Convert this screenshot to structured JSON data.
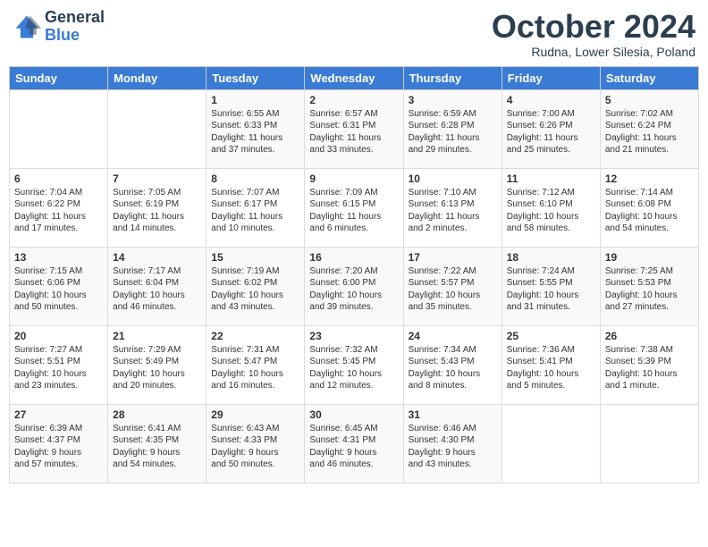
{
  "header": {
    "logo_general": "General",
    "logo_blue": "Blue",
    "month_title": "October 2024",
    "subtitle": "Rudna, Lower Silesia, Poland"
  },
  "days_of_week": [
    "Sunday",
    "Monday",
    "Tuesday",
    "Wednesday",
    "Thursday",
    "Friday",
    "Saturday"
  ],
  "weeks": [
    [
      {
        "day": "",
        "info": ""
      },
      {
        "day": "",
        "info": ""
      },
      {
        "day": "1",
        "info": "Sunrise: 6:55 AM\nSunset: 6:33 PM\nDaylight: 11 hours\nand 37 minutes."
      },
      {
        "day": "2",
        "info": "Sunrise: 6:57 AM\nSunset: 6:31 PM\nDaylight: 11 hours\nand 33 minutes."
      },
      {
        "day": "3",
        "info": "Sunrise: 6:59 AM\nSunset: 6:28 PM\nDaylight: 11 hours\nand 29 minutes."
      },
      {
        "day": "4",
        "info": "Sunrise: 7:00 AM\nSunset: 6:26 PM\nDaylight: 11 hours\nand 25 minutes."
      },
      {
        "day": "5",
        "info": "Sunrise: 7:02 AM\nSunset: 6:24 PM\nDaylight: 11 hours\nand 21 minutes."
      }
    ],
    [
      {
        "day": "6",
        "info": "Sunrise: 7:04 AM\nSunset: 6:22 PM\nDaylight: 11 hours\nand 17 minutes."
      },
      {
        "day": "7",
        "info": "Sunrise: 7:05 AM\nSunset: 6:19 PM\nDaylight: 11 hours\nand 14 minutes."
      },
      {
        "day": "8",
        "info": "Sunrise: 7:07 AM\nSunset: 6:17 PM\nDaylight: 11 hours\nand 10 minutes."
      },
      {
        "day": "9",
        "info": "Sunrise: 7:09 AM\nSunset: 6:15 PM\nDaylight: 11 hours\nand 6 minutes."
      },
      {
        "day": "10",
        "info": "Sunrise: 7:10 AM\nSunset: 6:13 PM\nDaylight: 11 hours\nand 2 minutes."
      },
      {
        "day": "11",
        "info": "Sunrise: 7:12 AM\nSunset: 6:10 PM\nDaylight: 10 hours\nand 58 minutes."
      },
      {
        "day": "12",
        "info": "Sunrise: 7:14 AM\nSunset: 6:08 PM\nDaylight: 10 hours\nand 54 minutes."
      }
    ],
    [
      {
        "day": "13",
        "info": "Sunrise: 7:15 AM\nSunset: 6:06 PM\nDaylight: 10 hours\nand 50 minutes."
      },
      {
        "day": "14",
        "info": "Sunrise: 7:17 AM\nSunset: 6:04 PM\nDaylight: 10 hours\nand 46 minutes."
      },
      {
        "day": "15",
        "info": "Sunrise: 7:19 AM\nSunset: 6:02 PM\nDaylight: 10 hours\nand 43 minutes."
      },
      {
        "day": "16",
        "info": "Sunrise: 7:20 AM\nSunset: 6:00 PM\nDaylight: 10 hours\nand 39 minutes."
      },
      {
        "day": "17",
        "info": "Sunrise: 7:22 AM\nSunset: 5:57 PM\nDaylight: 10 hours\nand 35 minutes."
      },
      {
        "day": "18",
        "info": "Sunrise: 7:24 AM\nSunset: 5:55 PM\nDaylight: 10 hours\nand 31 minutes."
      },
      {
        "day": "19",
        "info": "Sunrise: 7:25 AM\nSunset: 5:53 PM\nDaylight: 10 hours\nand 27 minutes."
      }
    ],
    [
      {
        "day": "20",
        "info": "Sunrise: 7:27 AM\nSunset: 5:51 PM\nDaylight: 10 hours\nand 23 minutes."
      },
      {
        "day": "21",
        "info": "Sunrise: 7:29 AM\nSunset: 5:49 PM\nDaylight: 10 hours\nand 20 minutes."
      },
      {
        "day": "22",
        "info": "Sunrise: 7:31 AM\nSunset: 5:47 PM\nDaylight: 10 hours\nand 16 minutes."
      },
      {
        "day": "23",
        "info": "Sunrise: 7:32 AM\nSunset: 5:45 PM\nDaylight: 10 hours\nand 12 minutes."
      },
      {
        "day": "24",
        "info": "Sunrise: 7:34 AM\nSunset: 5:43 PM\nDaylight: 10 hours\nand 8 minutes."
      },
      {
        "day": "25",
        "info": "Sunrise: 7:36 AM\nSunset: 5:41 PM\nDaylight: 10 hours\nand 5 minutes."
      },
      {
        "day": "26",
        "info": "Sunrise: 7:38 AM\nSunset: 5:39 PM\nDaylight: 10 hours\nand 1 minute."
      }
    ],
    [
      {
        "day": "27",
        "info": "Sunrise: 6:39 AM\nSunset: 4:37 PM\nDaylight: 9 hours\nand 57 minutes."
      },
      {
        "day": "28",
        "info": "Sunrise: 6:41 AM\nSunset: 4:35 PM\nDaylight: 9 hours\nand 54 minutes."
      },
      {
        "day": "29",
        "info": "Sunrise: 6:43 AM\nSunset: 4:33 PM\nDaylight: 9 hours\nand 50 minutes."
      },
      {
        "day": "30",
        "info": "Sunrise: 6:45 AM\nSunset: 4:31 PM\nDaylight: 9 hours\nand 46 minutes."
      },
      {
        "day": "31",
        "info": "Sunrise: 6:46 AM\nSunset: 4:30 PM\nDaylight: 9 hours\nand 43 minutes."
      },
      {
        "day": "",
        "info": ""
      },
      {
        "day": "",
        "info": ""
      }
    ]
  ]
}
